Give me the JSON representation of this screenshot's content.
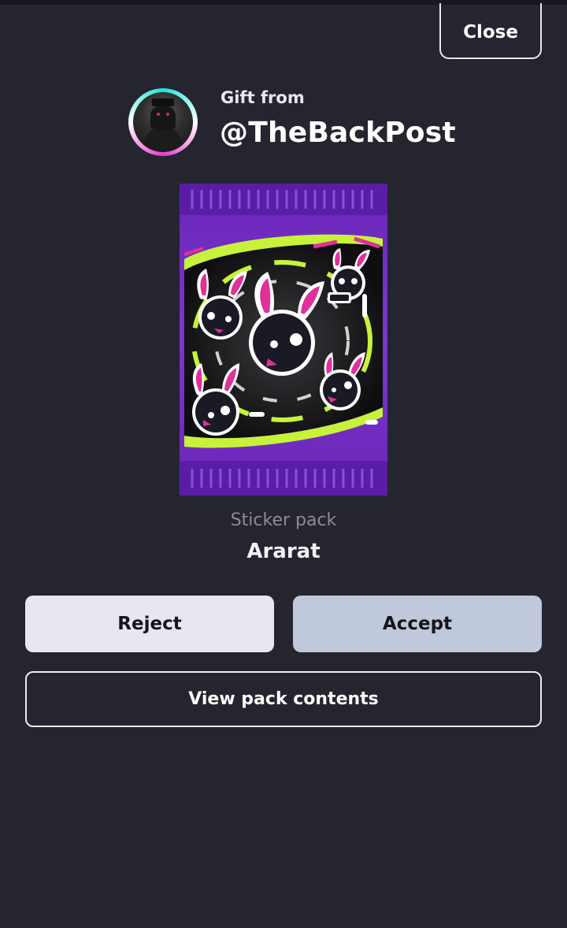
{
  "header": {
    "close_label": "Close"
  },
  "gift": {
    "from_label": "Gift from",
    "sender": "@TheBackPost"
  },
  "pack": {
    "type_label": "Sticker pack",
    "name": "Ararat"
  },
  "actions": {
    "reject_label": "Reject",
    "accept_label": "Accept",
    "view_label": "View pack contents"
  },
  "colors": {
    "background": "#25252f",
    "accept": "#c0c8dc",
    "reject": "#e7e7ef",
    "pack_purple": "#7a32c8",
    "pack_lime": "#c7f23a",
    "pack_pink": "#e0309a"
  }
}
